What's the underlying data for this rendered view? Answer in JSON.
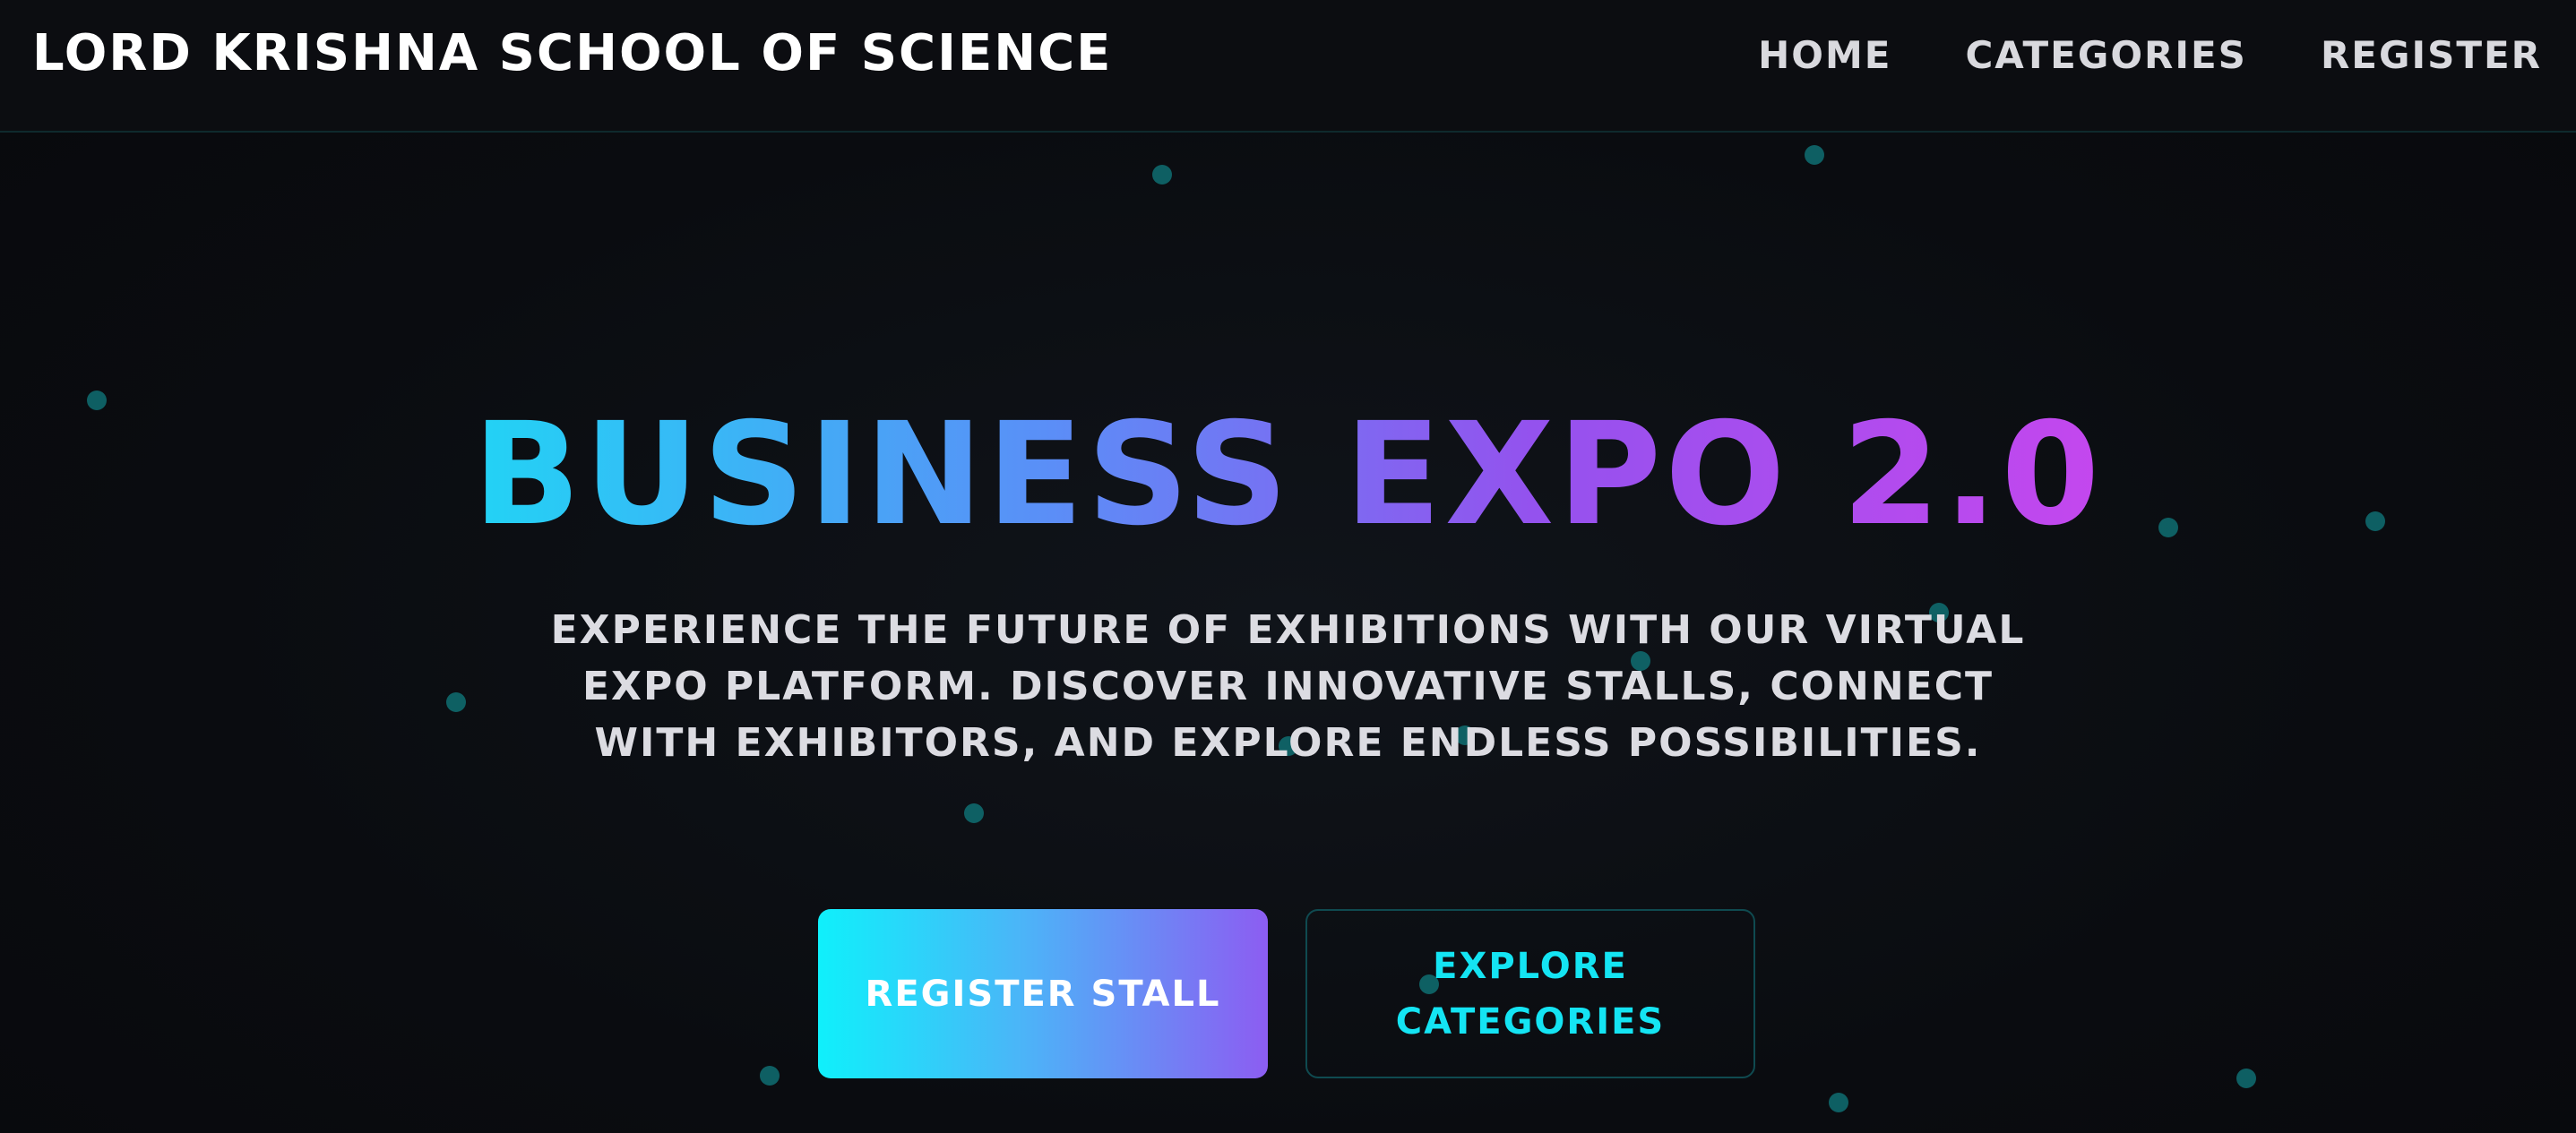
{
  "header": {
    "brand": "LORD KRISHNA SCHOOL OF SCIENCE",
    "nav": [
      {
        "label": "HOME"
      },
      {
        "label": "CATEGORIES"
      },
      {
        "label": "REGISTER"
      }
    ]
  },
  "hero": {
    "title": "BUSINESS EXPO 2.0",
    "subtitle": "EXPERIENCE THE FUTURE OF EXHIBITIONS WITH OUR VIRTUAL EXPO PLATFORM. DISCOVER INNOVATIVE STALLS, CONNECT WITH EXHIBITORS, AND EXPLORE ENDLESS POSSIBILITIES.",
    "primary_button": "REGISTER STALL",
    "secondary_button": "EXPLORE CATEGORIES"
  },
  "colors": {
    "background": "#0a0c10",
    "accent_cyan": "#14e4f3",
    "accent_purple": "#8c5df2",
    "gradient_start": "#22d3f5",
    "gradient_end": "#c447ee",
    "particle": "#0f6f72"
  }
}
